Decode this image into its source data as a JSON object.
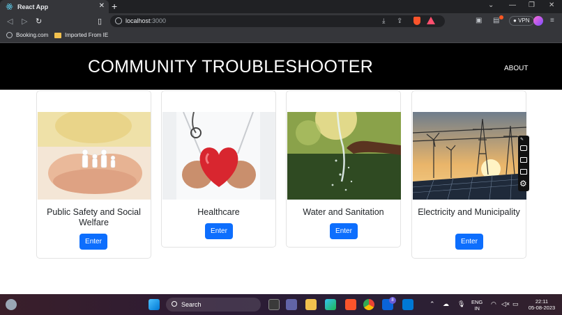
{
  "browser": {
    "tab_title": "React App",
    "tab_close": "✕",
    "new_tab": "+",
    "url_host": "localhost",
    "url_port": ":3000",
    "vpn_label": "VPN",
    "bookmarks": [
      {
        "label": "Booking.com",
        "icon": "globe-icon"
      },
      {
        "label": "Imported From IE",
        "icon": "folder-icon"
      }
    ]
  },
  "site": {
    "title": "COMMUNITY TROUBLESHOOTER",
    "nav_about": "ABOUT"
  },
  "cards": [
    {
      "title": "Public Safety and Social Welfare",
      "button": "Enter",
      "image": "hands-holding-paper-family"
    },
    {
      "title": "Healthcare",
      "button": "Enter",
      "image": "doctor-holding-red-heart"
    },
    {
      "title": "Water and Sanitation",
      "button": "Enter",
      "image": "hand-under-water-stream"
    },
    {
      "title": "Electricity and Municipality",
      "button": "Enter",
      "image": "solar-panels-power-lines"
    }
  ],
  "taskbar": {
    "search_placeholder": "Search",
    "lang_top": "ENG",
    "lang_bottom": "IN",
    "time": "22:11",
    "date": "05-08-2023",
    "mail_badge": "8"
  },
  "colors": {
    "header_bg": "#000000",
    "button_bg": "#0d6efd",
    "chrome_bg": "#35363a"
  }
}
